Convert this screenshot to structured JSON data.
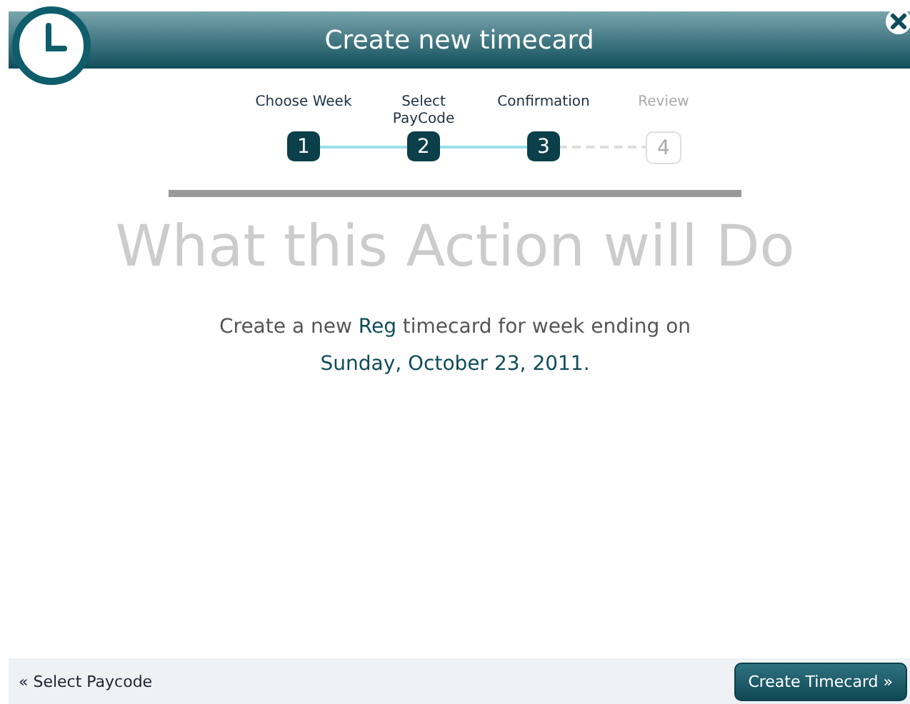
{
  "window": {
    "title": "Create new timecard"
  },
  "steps": [
    {
      "label": "Choose Week",
      "number": "1",
      "done": true
    },
    {
      "label": "Select PayCode",
      "number": "2",
      "done": true
    },
    {
      "label": "Confirmation",
      "number": "3",
      "done": true
    },
    {
      "label": "Review",
      "number": "4",
      "done": false
    }
  ],
  "heading": "What this Action will Do",
  "summary": [
    {
      "text": "Create a new ",
      "highlight": false
    },
    {
      "text": "Reg",
      "highlight": true
    },
    {
      "text": " timecard for week ending on ",
      "highlight": false
    },
    {
      "text": "Sunday, October 23, 2011.",
      "highlight": true
    }
  ],
  "footer": {
    "back_link": "« Select Paycode",
    "primary_button": "Create Timecard »"
  }
}
